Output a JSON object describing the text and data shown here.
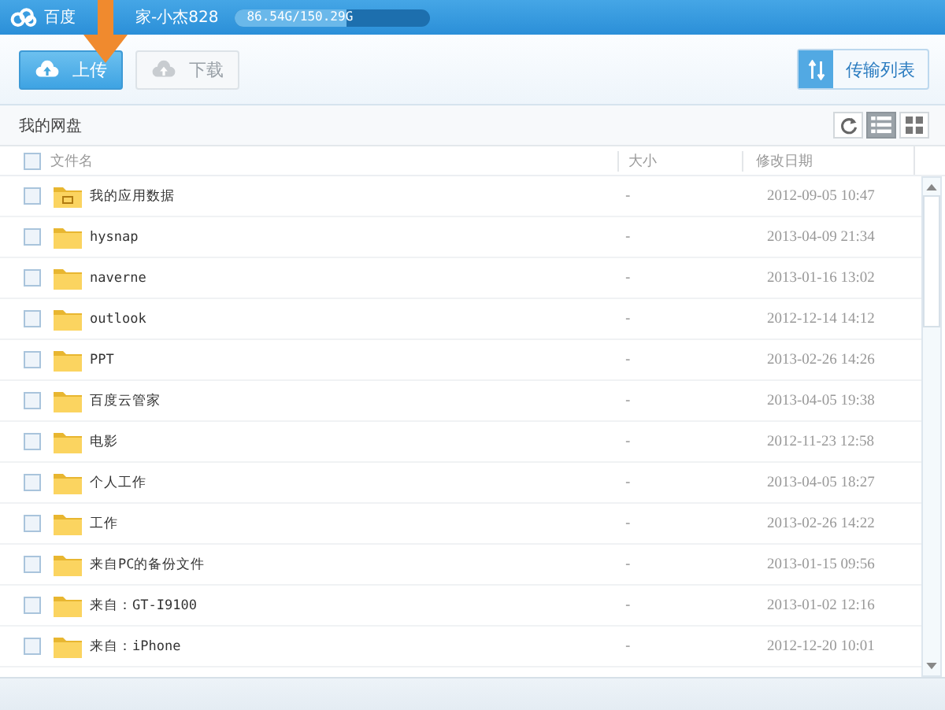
{
  "title_bar": {
    "title_visible_start": "百度",
    "title_visible_end": "家-小杰828",
    "storage": "86.54G/150.29G",
    "level": 0.576
  },
  "toolbar": {
    "buttons": [
      {
        "label": "上传",
        "disabled": false
      },
      {
        "label": "下载",
        "disabled": true
      }
    ],
    "transfer_list": "传输列表"
  },
  "breadcrumb": "我的网盘",
  "view_modes": [
    {
      "kind": "list",
      "selected": true
    },
    {
      "kind": "grid",
      "selected": false
    }
  ],
  "table": {
    "select_all_checked": false,
    "columns": [
      "文件名",
      "大小",
      "修改日期"
    ],
    "rows": [
      {
        "kind": "app",
        "name": "我的应用数据",
        "size": "-",
        "modified": "2012-09-05 10:47",
        "checked": false
      },
      {
        "kind": "folder",
        "name": "hysnap",
        "size": "-",
        "modified": "2013-04-09 21:34",
        "checked": false
      },
      {
        "kind": "folder",
        "name": "naverne",
        "size": "-",
        "modified": "2013-01-16 13:02",
        "checked": false
      },
      {
        "kind": "folder",
        "name": "outlook",
        "size": "-",
        "modified": "2012-12-14 14:12",
        "checked": false
      },
      {
        "kind": "folder",
        "name": "PPT",
        "size": "-",
        "modified": "2013-02-26 14:26",
        "checked": false
      },
      {
        "kind": "folder",
        "name": "百度云管家",
        "size": "-",
        "modified": "2013-04-05 19:38",
        "checked": false
      },
      {
        "kind": "folder",
        "name": "电影",
        "size": "-",
        "modified": "2012-11-23 12:58",
        "checked": false
      },
      {
        "kind": "folder",
        "name": "个人工作",
        "size": "-",
        "modified": "2013-04-05 18:27",
        "checked": false
      },
      {
        "kind": "folder",
        "name": "工作",
        "size": "-",
        "modified": "2013-02-26 14:22",
        "checked": false
      },
      {
        "kind": "folder",
        "name": "来自PC的备份文件",
        "size": "-",
        "modified": "2013-01-15 09:56",
        "checked": false
      },
      {
        "kind": "folder",
        "name": "来自：GT-I9100",
        "size": "-",
        "modified": "2013-01-02 12:16",
        "checked": false
      },
      {
        "kind": "folder",
        "name": "来自：iPhone",
        "size": "-",
        "modified": "2012-12-20 10:01",
        "checked": false
      }
    ]
  }
}
